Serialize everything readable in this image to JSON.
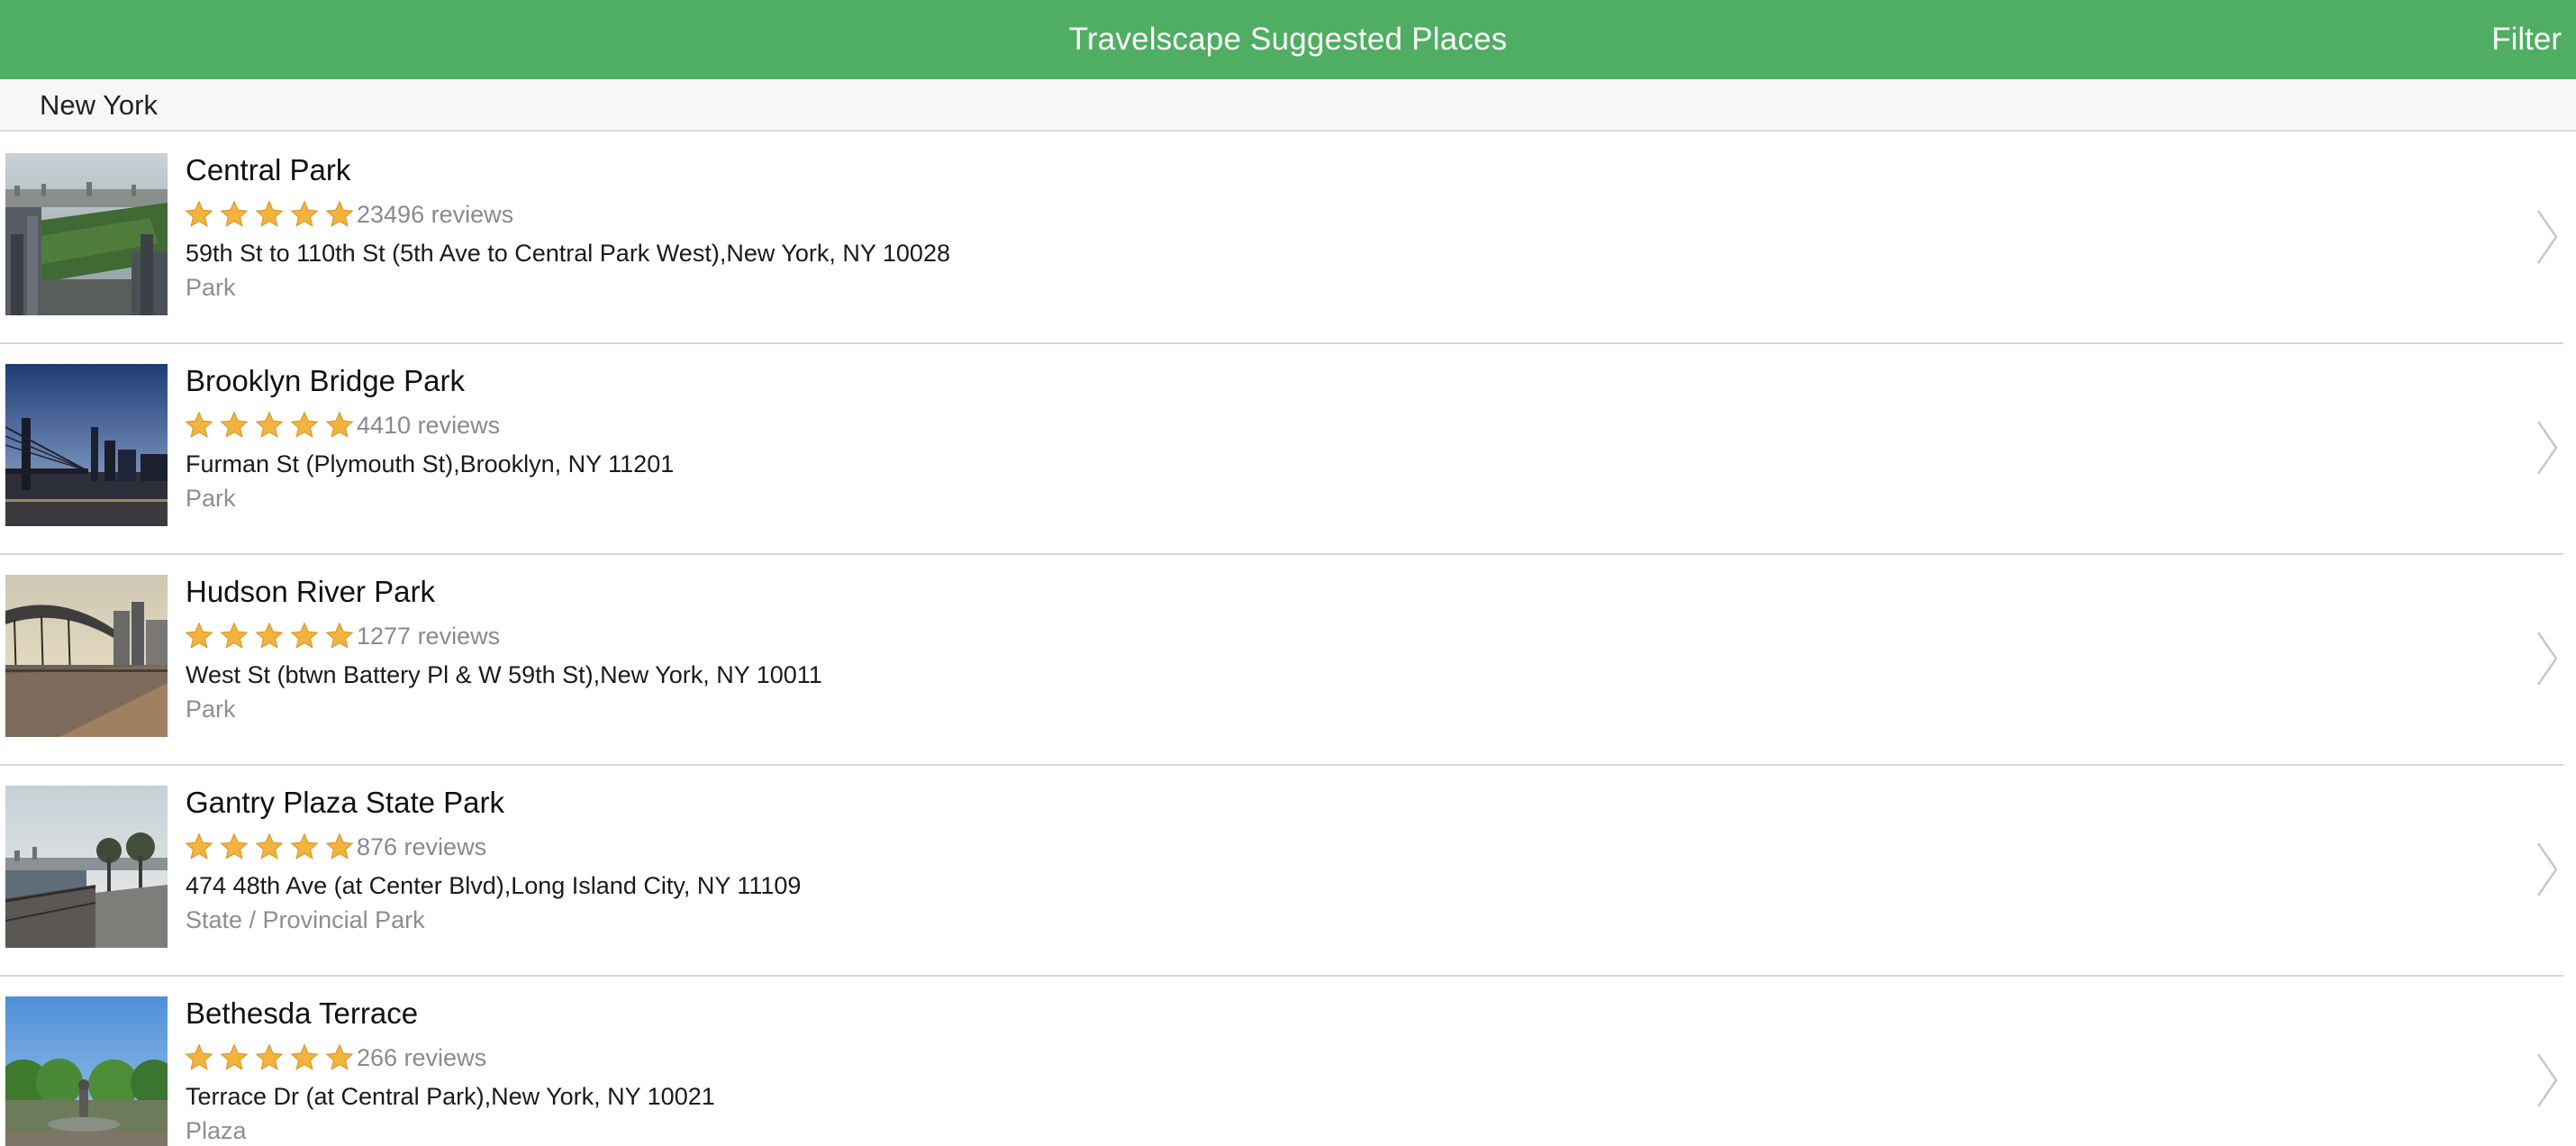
{
  "app": {
    "title": "Travelscape Suggested Places",
    "filter_label": "Filter",
    "accent_color": "#4fae62"
  },
  "section": {
    "title": "New York"
  },
  "places": [
    {
      "name": "Central Park",
      "rating": 5,
      "reviews": "23496 reviews",
      "address": "59th St to 110th St (5th Ave to Central Park West),New York, NY 10028",
      "category": "Park",
      "thumbnail": "central-park-aerial-photo"
    },
    {
      "name": "Brooklyn Bridge Park",
      "rating": 5,
      "reviews": "4410 reviews",
      "address": "Furman St (Plymouth St),Brooklyn, NY 11201",
      "category": "Park",
      "thumbnail": "brooklyn-bridge-dusk-photo"
    },
    {
      "name": "Hudson River Park",
      "rating": 5,
      "reviews": "1277 reviews",
      "address": "West St (btwn Battery Pl & W 59th St),New York, NY 10011",
      "category": "Park",
      "thumbnail": "hudson-river-pier-photo"
    },
    {
      "name": "Gantry Plaza State Park",
      "rating": 5,
      "reviews": "876 reviews",
      "address": "474 48th Ave (at Center Blvd),Long Island City, NY 11109",
      "category": "State / Provincial Park",
      "thumbnail": "gantry-plaza-waterfront-photo"
    },
    {
      "name": "Bethesda Terrace",
      "rating": 5,
      "reviews": "266 reviews",
      "address": "Terrace Dr (at Central Park),New York, NY 10021",
      "category": "Plaza",
      "thumbnail": "bethesda-terrace-photo"
    }
  ],
  "icons": {
    "star": "star-icon",
    "disclosure": "chevron-right-icon"
  },
  "colors": {
    "star_fill": "#f3b33d",
    "reviews_text": "#8a8a8a",
    "category_text": "#8e8e8e"
  }
}
